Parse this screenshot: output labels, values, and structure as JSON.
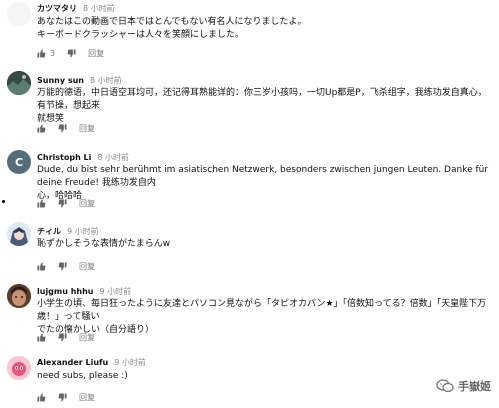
{
  "reply_label": "回复",
  "comments": [
    {
      "author": "カツマタリ",
      "time": "8 小时前",
      "lines": [
        "あなたはこの動画で日本ではとんでもない有名人になりましたよ。",
        "キーボードクラッシャーは人々を笑顔にしました。"
      ],
      "likes": "3",
      "avatar_icon": "empty-avatar-icon"
    },
    {
      "author": "Sunny sun",
      "time": "8 小时前",
      "lines": [
        "万能的德语，中日语空耳均可，还记得耳熟能详的：你三岁小孩吗，一切Up都是P，飞杀组字，我练功发自真心，有节操，想起来",
        "就想笑"
      ],
      "likes": "",
      "avatar_icon": "landscape-avatar-icon"
    },
    {
      "author": "Christoph Li",
      "time": "8 小时前",
      "lines": [
        "Dude, du bist sehr berühmt im asiatischen Netzwerk, besonders zwischen jungen Leuten. Danke für deine Freude! 我练功发自内",
        "心，哈哈哈"
      ],
      "likes": "",
      "avatar_letter": "C",
      "avatar_color": "#546e7a"
    },
    {
      "author": "チィル",
      "time": "9 小时前",
      "lines": [
        "恥ずかしそうな表情がたまらんw"
      ],
      "likes": "",
      "avatar_icon": "anime-avatar-icon"
    },
    {
      "author": "lujgmu hhhu",
      "time": "9 小时前",
      "lines": [
        "小学生の頃、毎日狂ったように友達とパソコン見ながら「タピオカパン★」「倍数知ってる？倍数」「天皇陛下万歳！」って騒い",
        "でたの懐かしい（自分語り）"
      ],
      "likes": "",
      "avatar_icon": "face-avatar-icon"
    },
    {
      "author": "Alexander Liufu",
      "time": "9 小时前",
      "lines": [
        "need subs, please :)"
      ],
      "likes": "",
      "avatar_icon": "pink-character-avatar-icon"
    }
  ],
  "watermark": "手嶽姬"
}
